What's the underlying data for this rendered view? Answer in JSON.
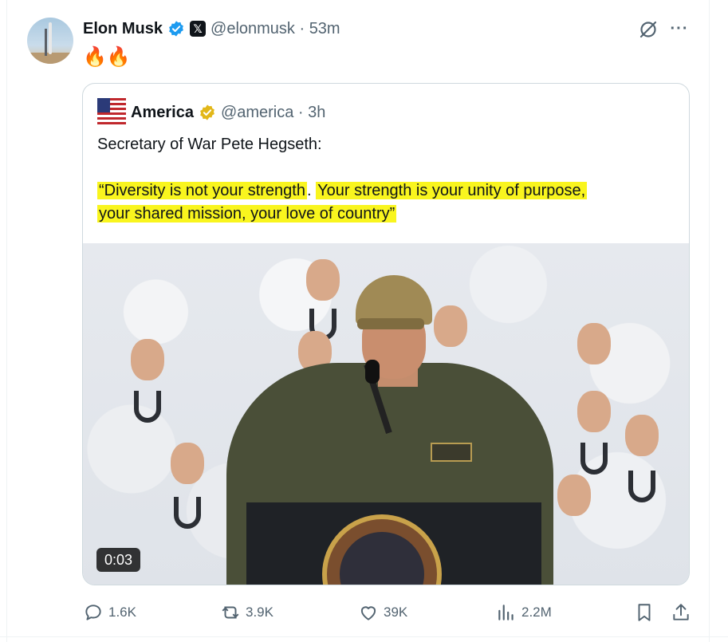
{
  "post": {
    "author_name": "Elon Musk",
    "x_badge": "𝕏",
    "handle_time": "@elonmusk · 53m",
    "text": "🔥🔥",
    "more": "···"
  },
  "quote": {
    "author_name": "America",
    "handle_time": "@america · 3h",
    "intro": "Secretary of War Pete Hegseth:",
    "quote_line1_part1": "“Diversity is not your strength",
    "quote_line1_part2": ". ",
    "quote_line1_part3": "Your strength is your unity of purpose,",
    "quote_line2": "your shared mission, your love of country”",
    "video_timer": "0:03"
  },
  "actions": {
    "replies": "1.6K",
    "reposts": "3.9K",
    "likes": "39K",
    "views": "2.2M"
  },
  "icons": {
    "verified": "verified-badge-icon",
    "gold_verified": "gold-verified-badge-icon",
    "grok": "grok-icon",
    "reply": "reply-icon",
    "repost": "repost-icon",
    "like": "like-icon",
    "views": "views-icon",
    "bookmark": "bookmark-icon",
    "share": "share-icon"
  },
  "colors": {
    "verified_blue": "#1d9bf0",
    "verified_gold": "#e2b719",
    "highlight": "#f9f51e",
    "muted": "#536471"
  }
}
